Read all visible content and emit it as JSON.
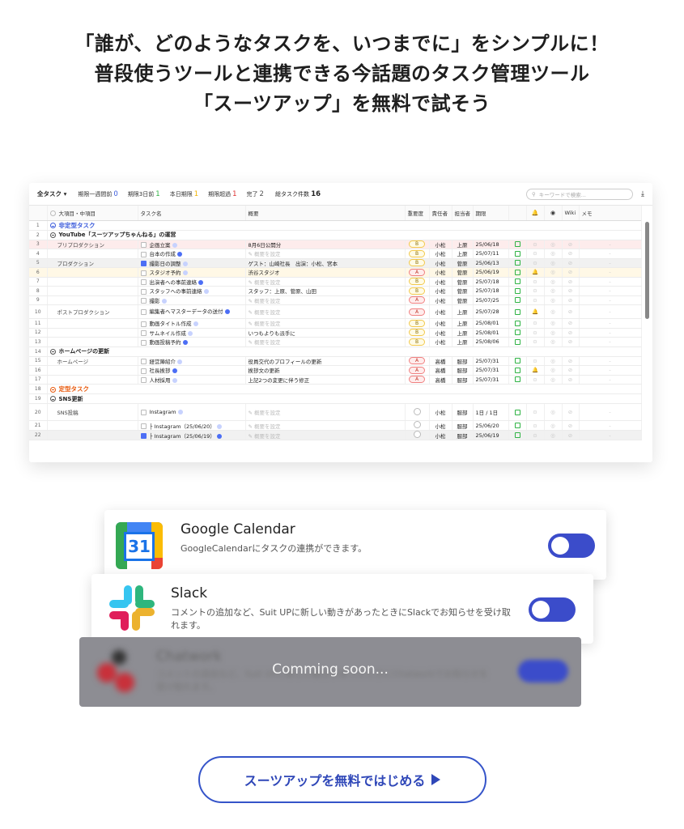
{
  "headline": [
    "「誰が、どのようなタスクを、いつまでに」をシンプルに！",
    "普段使うツールと連携できる今話題のタスク管理ツール",
    "「スーツアップ」を無料で試そう"
  ],
  "toolbar": {
    "scope": "全タスク ▾",
    "filters": [
      {
        "label": "期限一週間前",
        "count": "0",
        "color": "#3b5bdb"
      },
      {
        "label": "期限3日前",
        "count": "1",
        "color": "#2fb344"
      },
      {
        "label": "本日期限",
        "count": "1",
        "color": "#f2b400"
      },
      {
        "label": "期限超過",
        "count": "1",
        "color": "#e03131"
      },
      {
        "label": "完了",
        "count": "2",
        "color": "#555555"
      }
    ],
    "total_label": "総タスク件数",
    "total_count": "16",
    "search_placeholder": "キーワードで検索...",
    "download_icon": "download-icon"
  },
  "columns": [
    "",
    "大項目・中項目",
    "タスク名",
    "概要",
    "重要度",
    "責任者",
    "担当者",
    "期限",
    "",
    "",
    "Wiki",
    "メモ"
  ],
  "rows": [
    {
      "n": "1",
      "cat": "非定型タスク",
      "type": "cat blue"
    },
    {
      "n": "2",
      "cat": "YouTube「スーツアップちゃんねる」の運営",
      "type": "cat sec"
    },
    {
      "n": "3",
      "sub": "プリプロダクション",
      "task": "企画立案",
      "summary": "8月6日公開分",
      "pri": "B",
      "owner": "小松",
      "assignee": "上原",
      "due": "25/06/18",
      "type": "pink"
    },
    {
      "n": "4",
      "task": "台本の作成",
      "summary": "概要を設定",
      "ph": true,
      "pri": "B",
      "owner": "小松",
      "assignee": "上原",
      "due": "25/07/11"
    },
    {
      "n": "5",
      "sub": "プロダクション",
      "task": "撮影日の調整",
      "summary": "ゲスト：山崎社長　出演：小松、宮本",
      "pri": "B",
      "owner": "小松",
      "assignee": "菅原",
      "due": "25/06/13",
      "type": "gray",
      "checked": true
    },
    {
      "n": "6",
      "task": "スタジオ予約",
      "summary": "渋谷スタジオ",
      "pri": "A",
      "owner": "小松",
      "assignee": "菅原",
      "due": "25/06/19",
      "type": "yellow",
      "bell": true
    },
    {
      "n": "7",
      "task": "出演者への事前連絡",
      "summary": "概要を設定",
      "ph": true,
      "pri": "B",
      "owner": "小松",
      "assignee": "菅原",
      "due": "25/07/18"
    },
    {
      "n": "8",
      "task": "スタッフへの事前連絡",
      "summary": "スタッフ：上原、菅原、山田",
      "pri": "B",
      "owner": "小松",
      "assignee": "菅原",
      "due": "25/07/18"
    },
    {
      "n": "9",
      "task": "撮影",
      "summary": "概要を設定",
      "ph": true,
      "pri": "A",
      "owner": "小松",
      "assignee": "菅原",
      "due": "25/07/25"
    },
    {
      "n": "10",
      "sub": "ポストプロダクション",
      "task": "編集者へマスターデータの送付",
      "summary": "概要を設定",
      "ph": true,
      "pri": "A",
      "owner": "小松",
      "assignee": "上原",
      "due": "25/07/28",
      "type": "tall",
      "bell": true
    },
    {
      "n": "11",
      "task": "動画タイトル作成",
      "summary": "概要を設定",
      "ph": true,
      "pri": "B",
      "owner": "小松",
      "assignee": "上原",
      "due": "25/08/01"
    },
    {
      "n": "12",
      "task": "サムネイル作成",
      "summary": "いつもよりも派手に",
      "pri": "B",
      "owner": "小松",
      "assignee": "上原",
      "due": "25/08/01"
    },
    {
      "n": "13",
      "task": "動画投稿予約",
      "summary": "概要を設定",
      "ph": true,
      "pri": "B",
      "owner": "小松",
      "assignee": "上原",
      "due": "25/08/06"
    },
    {
      "n": "14",
      "cat": "ホームページの更新",
      "type": "cat sec"
    },
    {
      "n": "15",
      "sub": "ホームページ",
      "task": "経営陣紹介",
      "summary": "役員交代のプロフィールの更新",
      "pri": "A",
      "owner": "高橋",
      "assignee": "服部",
      "due": "25/07/31"
    },
    {
      "n": "16",
      "task": "社長挨拶",
      "summary": "挨拶文の更新",
      "pri": "A",
      "owner": "高橋",
      "assignee": "服部",
      "due": "25/07/31",
      "bell": true
    },
    {
      "n": "17",
      "task": "人材採用",
      "summary": "上記2つの変更に伴う修正",
      "pri": "A",
      "owner": "高橋",
      "assignee": "服部",
      "due": "25/07/31"
    },
    {
      "n": "18",
      "cat": "定型タスク",
      "type": "cat orange"
    },
    {
      "n": "19",
      "cat": "SNS更新",
      "type": "cat sec"
    },
    {
      "n": "20",
      "sub": "SNS投稿",
      "task": "Instagram",
      "summary": "概要を設定",
      "ph": true,
      "pri": "",
      "owner": "小松",
      "assignee": "服部",
      "due": "1日 / 1日",
      "type": "r20"
    },
    {
      "n": "21",
      "task": "├ Instagram（25/06/20）",
      "summary": "概要を設定",
      "ph": true,
      "pri": "",
      "owner": "小松",
      "assignee": "服部",
      "due": "25/06/20"
    },
    {
      "n": "22",
      "task": "├ Instagram（25/06/19）",
      "summary": "概要を設定",
      "ph": true,
      "pri": "",
      "owner": "小松",
      "assignee": "服部",
      "due": "25/06/19",
      "type": "gray",
      "checked": true
    }
  ],
  "integrations": {
    "google": {
      "name": "Google Calendar",
      "desc": "GoogleCalendarにタスクの連携ができます。",
      "icon": "google-calendar-icon",
      "icon_text": "31"
    },
    "slack": {
      "name": "Slack",
      "desc": "コメントの追加など、Suit UPに新しい動きがあったときにSlackでお知らせを受け取れます。",
      "icon": "slack-icon"
    },
    "chatwork": {
      "name": "Chatwork",
      "desc": "コメントの追加など、Suit UPに新しい動きがあったときにChatworkでお知らせを受け取れます。",
      "button": "連携",
      "soon": "Comming soon..."
    }
  },
  "cta": {
    "label": "スーツアップを無料ではじめる"
  },
  "colors": {
    "accent": "#3b4cca",
    "cta": "#3554c9"
  }
}
